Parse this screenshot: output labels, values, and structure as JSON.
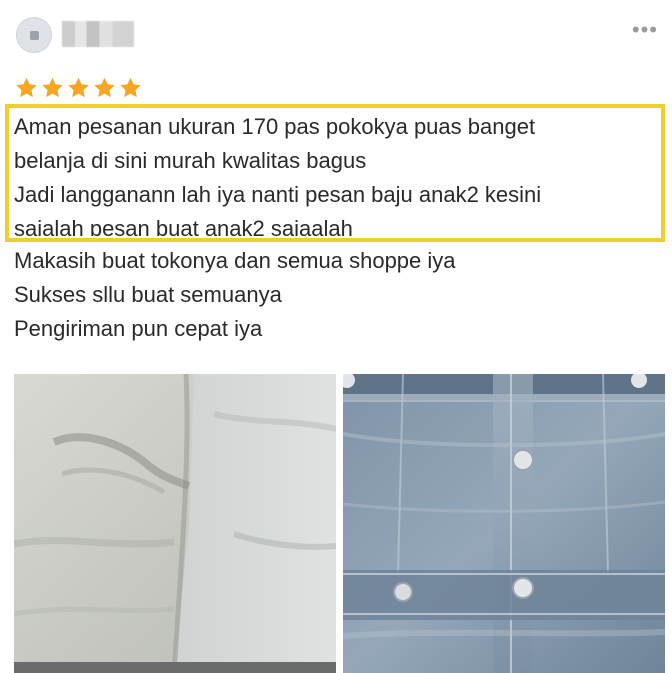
{
  "review": {
    "username": "",
    "rating": 5,
    "max_rating": 5,
    "highlighted_lines": [
      "Aman pesanan ukuran 170 pas pokokya puas banget",
      "belanja di sini murah kwalitas bagus",
      "Jadi langganann lah iya nanti pesan baju anak2 kesini",
      "sajalah pesan buat anak2 sajaalah"
    ],
    "lines": [
      "Makasih buat tokonya dan semua shoppe iya",
      "Sukses sllu buat semuanya",
      "Pengiriman pun cepat iya"
    ]
  },
  "icons": {
    "star": "star-icon",
    "more": "more-dots-icon",
    "avatar": "avatar"
  },
  "colors": {
    "star": "#f6a623",
    "highlight_border": "#f0cf2a",
    "text": "#2a2a2a"
  }
}
